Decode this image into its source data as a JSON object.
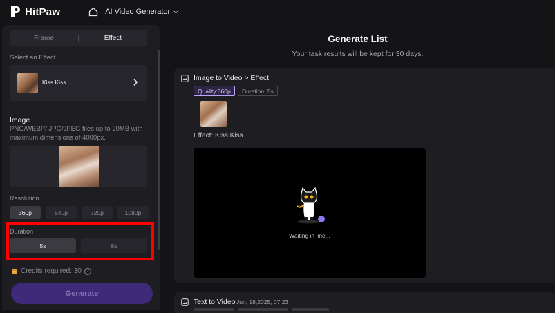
{
  "topbar": {
    "logo_text": "HitPaw",
    "app_name": "AI Video Generator"
  },
  "sidebar": {
    "tabs": [
      {
        "label": "Frame",
        "active": false
      },
      {
        "label": "Effect",
        "active": true
      }
    ],
    "effect_section_label": "Select an Effect",
    "effect_name": "Kiss Kiss",
    "image_title": "Image",
    "image_desc": "PNG/WEBP/ JPG/JPEG files up to 20MB with maximum dimensions of 4000px.",
    "resolution_label": "Resolution",
    "resolutions": [
      "360p",
      "540p",
      "720p",
      "1080p"
    ],
    "selected_resolution": "360p",
    "duration_label": "Duration",
    "durations": [
      "5s",
      "8s"
    ],
    "selected_duration": "5s",
    "credits_text": "Credits required: 30",
    "help_glyph": "?",
    "generate_label": "Generate"
  },
  "main": {
    "title": "Generate List",
    "subtitle": "Your task results will be kept for 30 days.",
    "task1": {
      "title": "Image to Video > Effect",
      "quality_badge": "Quality:360p",
      "duration_badge": "Duration: 5s",
      "effect_text": "Effect: Kiss Kiss",
      "status_text": "Waiting in line..."
    },
    "task2": {
      "title": "Text to Video",
      "date": "Jun, 18,2025, 07:23"
    }
  },
  "colors": {
    "accent": "#3f2a7a",
    "highlight_box": "#ff0000",
    "quality_badge_border": "#b9a3ff"
  }
}
